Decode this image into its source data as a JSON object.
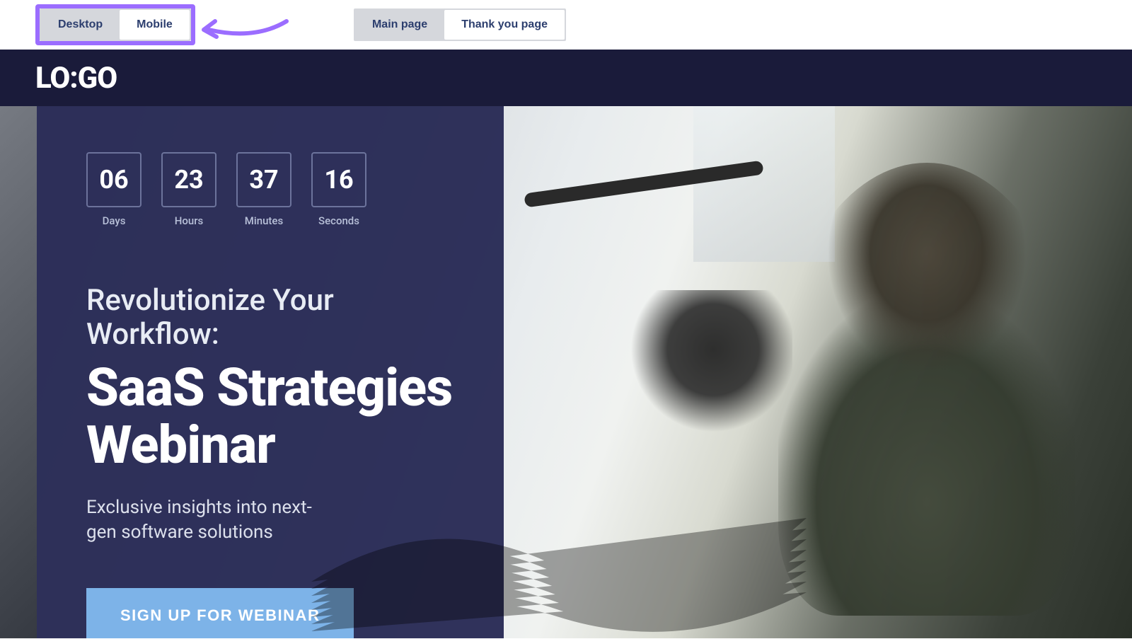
{
  "toolbar": {
    "device_tabs": {
      "desktop": "Desktop",
      "mobile": "Mobile"
    },
    "page_tabs": {
      "main": "Main page",
      "thankyou": "Thank you page"
    }
  },
  "header": {
    "logo": "LO:GO"
  },
  "hero": {
    "countdown": {
      "days": {
        "value": "06",
        "label": "Days"
      },
      "hours": {
        "value": "23",
        "label": "Hours"
      },
      "minutes": {
        "value": "37",
        "label": "Minutes"
      },
      "seconds": {
        "value": "16",
        "label": "Seconds"
      }
    },
    "overline": "Revolutionize Your Workflow:",
    "title": "SaaS Strategies Webinar",
    "subtitle": "Exclusive insights into next-gen software solutions",
    "cta": "SIGN UP FOR WEBINAR"
  },
  "colors": {
    "highlight": "#9b6dff",
    "panel": "#20224e",
    "cta": "#7db3e8"
  }
}
